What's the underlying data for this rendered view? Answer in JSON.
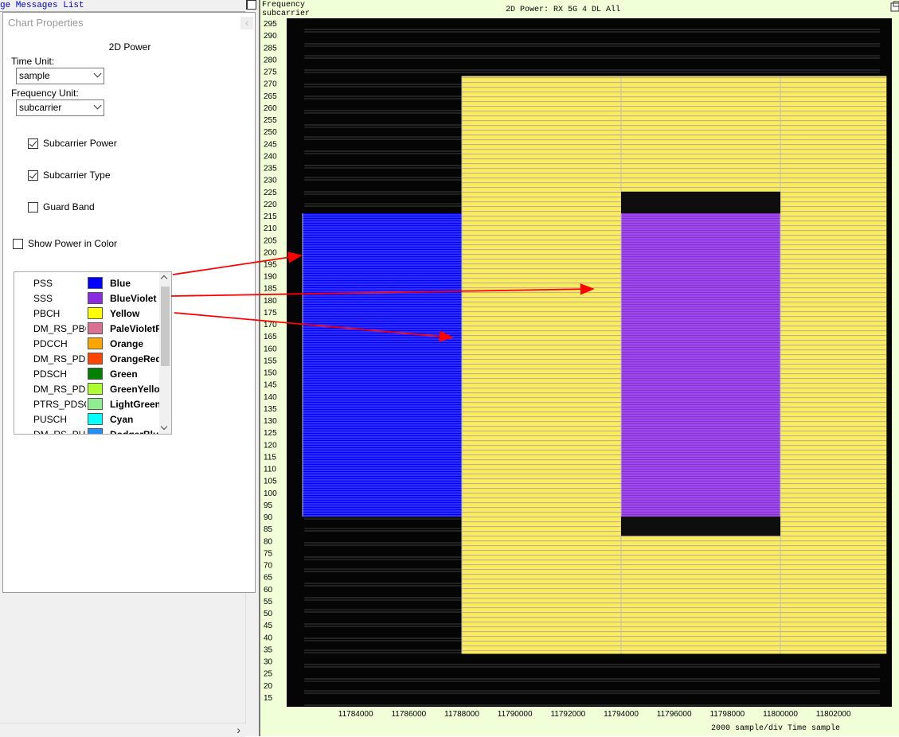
{
  "app": {
    "messages_list_title": "ge Messages List"
  },
  "props": {
    "title": "Chart Properties",
    "close_glyph": "‹",
    "heading": "2D Power",
    "time_unit_label": "Time Unit:",
    "time_unit_value": "sample",
    "freq_unit_label": "Frequency Unit:",
    "freq_unit_value": "subcarrier",
    "checkboxes": [
      {
        "label": "Subcarrier Power",
        "checked": true
      },
      {
        "label": "Subcarrier Type",
        "checked": true
      },
      {
        "label": "Guard Band",
        "checked": false
      }
    ],
    "show_power_label": "Show Power in Color",
    "show_power_checked": false,
    "legend": [
      {
        "name": "PSS",
        "color_name": "Blue",
        "color": "#0000ff"
      },
      {
        "name": "SSS",
        "color_name": "BlueViolet",
        "color": "#8a2be2"
      },
      {
        "name": "PBCH",
        "color_name": "Yellow",
        "color": "#ffff00"
      },
      {
        "name": "DM_RS_PBC",
        "color_name": "PaleVioletF",
        "color": "#db7093"
      },
      {
        "name": "PDCCH",
        "color_name": "Orange",
        "color": "#ffa500"
      },
      {
        "name": "DM_RS_PDC",
        "color_name": "OrangeRed",
        "color": "#ff4500"
      },
      {
        "name": "PDSCH",
        "color_name": "Green",
        "color": "#008000"
      },
      {
        "name": "DM_RS_PDS",
        "color_name": "GreenYello",
        "color": "#adff2f"
      },
      {
        "name": "PTRS_PDSCH",
        "color_name": "LightGreen",
        "color": "#90ee90"
      },
      {
        "name": "PUSCH",
        "color_name": "Cyan",
        "color": "#00ffff"
      },
      {
        "name": "DM_RS_PUS",
        "color_name": "DodgerBlu",
        "color": "#1e90ff"
      }
    ]
  },
  "chart": {
    "title": "2D Power: RX 5G 4 DL All",
    "y_unit_line1": "Frequency",
    "y_unit_line2": "subcarrier",
    "x_footer": "2000 sample/div  Time sample"
  },
  "chart_data": {
    "type": "heatmap",
    "title": "2D Power: RX 5G 4 DL All",
    "ylabel": "Frequency subcarrier",
    "xlabel": "Time sample",
    "x_scale": "2000 sample/div",
    "xlim": [
      11781400,
      11804200
    ],
    "ylim": [
      11,
      297
    ],
    "x_ticks": [
      11784000,
      11786000,
      11788000,
      11790000,
      11792000,
      11794000,
      11796000,
      11798000,
      11800000,
      11802000
    ],
    "y_ticks": [
      15,
      20,
      25,
      30,
      35,
      40,
      45,
      50,
      55,
      60,
      65,
      70,
      75,
      80,
      85,
      90,
      95,
      100,
      105,
      110,
      115,
      120,
      125,
      130,
      135,
      140,
      145,
      150,
      155,
      160,
      165,
      170,
      175,
      180,
      185,
      190,
      195,
      200,
      205,
      210,
      215,
      220,
      225,
      230,
      235,
      240,
      245,
      250,
      255,
      260,
      265,
      270,
      275,
      280,
      285,
      290,
      295
    ],
    "grid": false,
    "regions": [
      {
        "label": "PSS",
        "color": "#0000ff",
        "x": [
          11782000,
          11788000
        ],
        "y": [
          90,
          216
        ]
      },
      {
        "label": "PBCH",
        "x": [
          11788000,
          11794000
        ],
        "y": [
          33,
          273
        ],
        "color": "#ffff00"
      },
      {
        "label": "PBCH",
        "x": [
          11794000,
          11800000
        ],
        "y": [
          33,
          273
        ],
        "color": "#ffff00"
      },
      {
        "label": "SSS",
        "x": [
          11794000,
          11800000
        ],
        "y": [
          90,
          216
        ],
        "color": "#8a2be2"
      },
      {
        "label": "PBCH",
        "x": [
          11800000,
          11804000
        ],
        "y": [
          33,
          273
        ],
        "color": "#ffff00"
      }
    ]
  }
}
